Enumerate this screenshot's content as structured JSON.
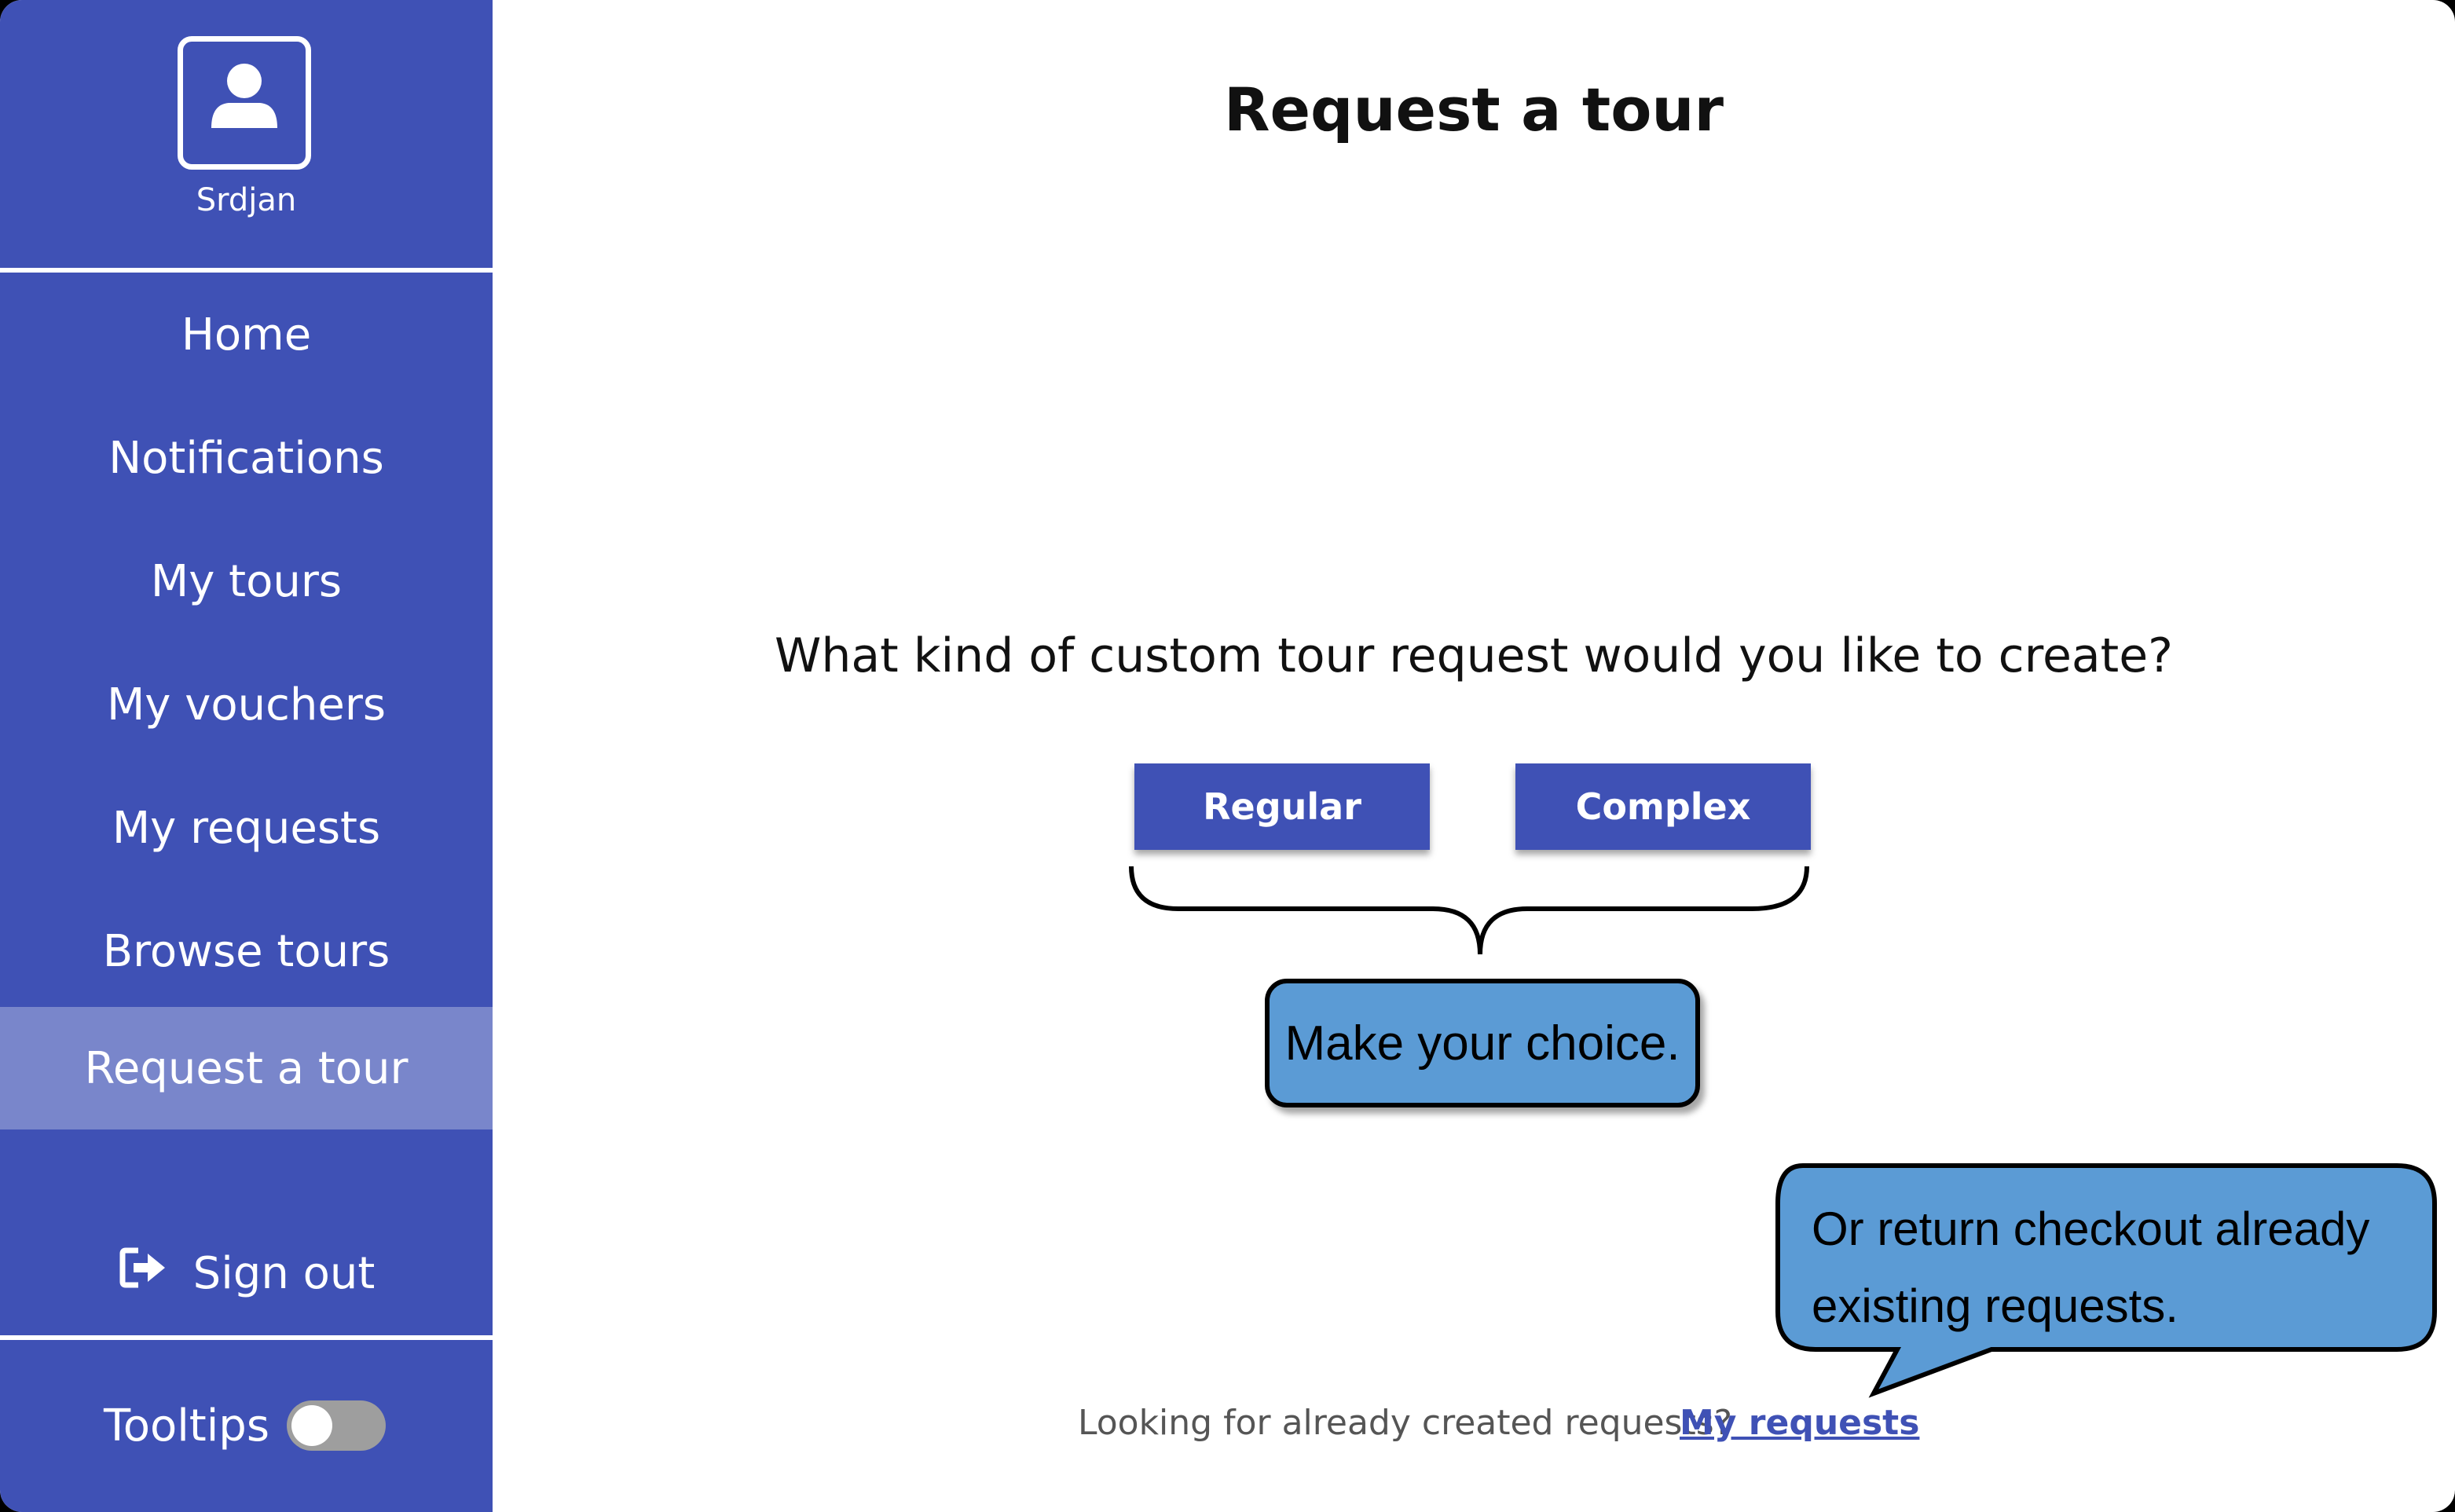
{
  "user": {
    "name": "Srdjan",
    "avatar_icon": "user-icon"
  },
  "sidebar": {
    "items": [
      {
        "label": "Home"
      },
      {
        "label": "Notifications"
      },
      {
        "label": "My tours"
      },
      {
        "label": "My vouchers"
      },
      {
        "label": "My requests"
      },
      {
        "label": "Browse tours"
      },
      {
        "label": "Request a tour",
        "active": true
      }
    ],
    "sign_out_label": "Sign out",
    "sign_out_icon": "sign-out-icon",
    "tooltips_label": "Tooltips",
    "tooltips_enabled": false
  },
  "main": {
    "title": "Request a tour",
    "question": "What kind of custom tour request would you like to create?",
    "regular_button": "Regular",
    "complex_button": "Complex",
    "choice_callout": "Make your choice.",
    "requests_callout_line1": "Or return checkout already",
    "requests_callout_line2": "existing requests.",
    "footer_text": "Looking for already created requests?",
    "footer_link": "My requests"
  },
  "colors": {
    "sidebar": "#3f51b5",
    "sidebar_active": "#7986cb",
    "callout": "#5b9bd5",
    "link": "#3f51b5"
  }
}
